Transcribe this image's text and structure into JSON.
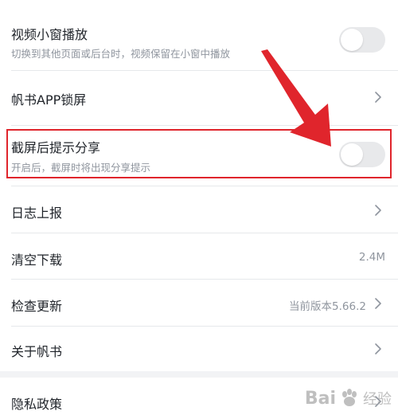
{
  "settings": {
    "video_pip": {
      "title": "视频小窗播放",
      "desc": "切换到其他页面或后台时，视频保留在小窗中播放"
    },
    "app_lock": {
      "title": "帆书APP锁屏"
    },
    "screenshot_share": {
      "title": "截屏后提示分享",
      "desc": "开启后，截屏时将出现分享提示"
    },
    "log_report": {
      "title": "日志上报"
    },
    "clear_downloads": {
      "title": "清空下载",
      "value": "2.4M"
    },
    "check_update": {
      "title": "检查更新",
      "value": "当前版本5.66.2"
    },
    "about": {
      "title": "关于帆书"
    },
    "privacy": {
      "title": "隐私政策"
    }
  },
  "watermark": {
    "brand": "Bai",
    "suffix": "经验"
  },
  "colors": {
    "highlight": "#e0252c",
    "toggle_off": "#e8e9eb",
    "text_primary": "#1f2329",
    "text_secondary": "#8f959e"
  }
}
